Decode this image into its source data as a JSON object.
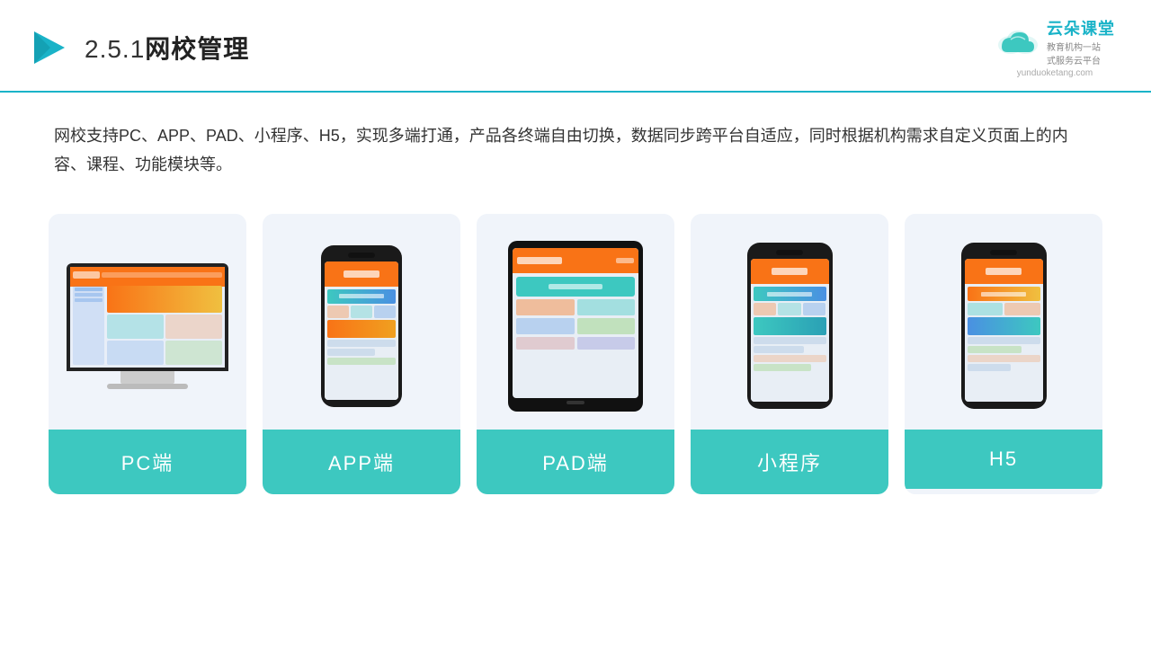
{
  "header": {
    "title_number": "2.5.1",
    "title_chinese": "网校管理",
    "brand_name": "云朵课堂",
    "brand_tagline_line1": "教育机构一站",
    "brand_tagline_line2": "式服务云平台",
    "brand_url": "yunduoketang.com"
  },
  "description": {
    "text": "网校支持PC、APP、PAD、小程序、H5，实现多端打通，产品各终端自由切换，数据同步跨平台自适应，同时根据机构需求自定义页面上的内容、课程、功能模块等。"
  },
  "cards": [
    {
      "id": "pc",
      "label": "PC端"
    },
    {
      "id": "app",
      "label": "APP端"
    },
    {
      "id": "pad",
      "label": "PAD端"
    },
    {
      "id": "miniapp",
      "label": "小程序"
    },
    {
      "id": "h5",
      "label": "H5"
    }
  ],
  "colors": {
    "accent": "#3dc8c0",
    "border": "#1ab3c8",
    "card_bg": "#f0f4fa",
    "orange": "#f97316"
  }
}
